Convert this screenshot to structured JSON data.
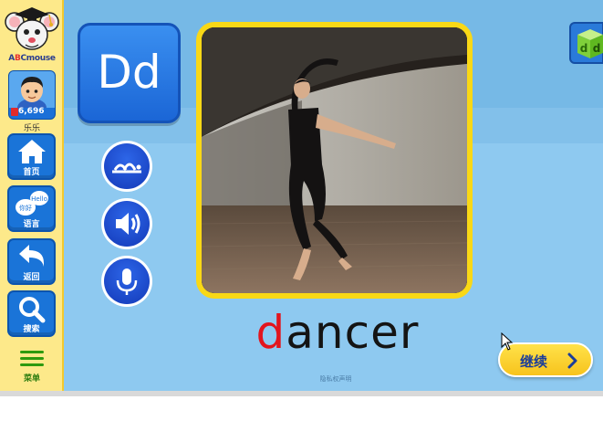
{
  "sidebar": {
    "logo": {
      "prefix": "A",
      "mid": "B",
      "suffix": "Cmouse"
    },
    "avatar": {
      "score": "6,696",
      "name": "乐乐"
    },
    "nav": [
      {
        "label": "首页",
        "icon": "home-icon"
      },
      {
        "label": "语言",
        "icon": "language-speech-icon"
      },
      {
        "label": "返回",
        "icon": "back-arrow-icon"
      },
      {
        "label": "搜索",
        "icon": "search-icon"
      }
    ],
    "menu_label": "菜单"
  },
  "lesson": {
    "letter": "Dd",
    "word_first": "d",
    "word_rest": "ancer",
    "privacy_text": "隐私权声明",
    "continue_label": "继续"
  },
  "controls": {
    "syllable_icon": "syllable-icon",
    "speaker_icon": "speaker-icon",
    "microphone_icon": "microphone-icon"
  },
  "colors": {
    "accent_blue": "#1a74d8",
    "word_highlight": "#e2151d",
    "frame_yellow": "#f9d816",
    "sidebar_yellow": "#fde98a",
    "background_blue": "#8ec9f0"
  }
}
